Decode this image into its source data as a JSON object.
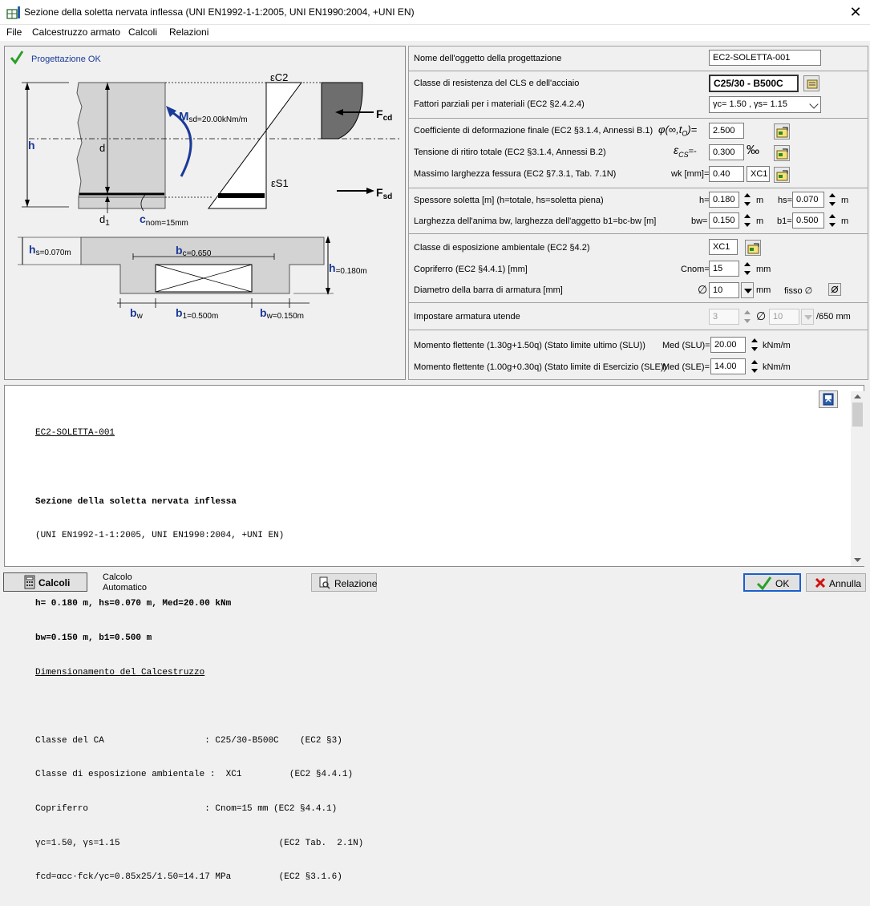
{
  "window": {
    "title": "Sezione della soletta nervata inflessa (UNI EN1992-1-1:2005, UNI EN1990:2004, +UNI EN)",
    "close": "✕"
  },
  "menu": [
    "File",
    "Calcestruzzo armato",
    "Calcoli",
    "Relazioni"
  ],
  "diagram": {
    "status": "Progettazione OK",
    "eps_c2": "εC2",
    "eps_s1": "εS1",
    "m_label": "M",
    "m_sub": "sd=20.00kNm/m",
    "f_cd": "F",
    "f_cd_sub": "cd",
    "f_sd": "F",
    "f_sd_sub": "sd",
    "h": "h",
    "d": "d",
    "d1": "d",
    "d1_sub": "1",
    "cnom": "c",
    "cnom_sub": "nom=15mm",
    "hs": "h",
    "hs_sub": "s=0.070m",
    "bc": "b",
    "bc_sub": "c=0.650",
    "h2": "h",
    "h2_sub": "=0.180m",
    "bw_left": "b",
    "bw_left_sub": "w",
    "b1": "b",
    "b1_sub": "1=0.500m",
    "bw_right": "b",
    "bw_right_sub": "w=0.150m"
  },
  "form": {
    "name_label": "Nome dell'oggetto della progettazione",
    "name_value": "EC2-SOLETTA-001",
    "class_label": "Classe di resistenza del CLS e dell'acciaio",
    "class_value": "C25/30 - B500C",
    "factors_label": "Fattori parziali per i materiali (EC2 §2.4.2.4)",
    "factors_value": "γc= 1.50 , γs= 1.15",
    "creep_label": "Coefficiente di deformazione finale (EC2 §3.1.4, Annessi B.1)",
    "creep_symbol": "φ(∞,t",
    "creep_symbol_sub": "O",
    "creep_symbol_end": ")=",
    "creep_value": "2.500",
    "shrink_label": "Tensione di ritiro totale (EC2 §3.1.4, Annessi B.2)",
    "shrink_symbol": "ε",
    "shrink_symbol_sub": "CS",
    "shrink_symbol_end": "=-",
    "shrink_value": "0.300",
    "shrink_unit": "‰",
    "crack_label": "Massimo larghezza fessura (EC2 §7.3.1, Tab. 7.1N)",
    "crack_symbol": "wk [mm]=",
    "crack_value": "0.40",
    "crack_class": "XC1",
    "thick_label": "Spessore soletta [m] (h=totale, hs=soletta piena)",
    "h_label": "h=",
    "h_value": "0.180",
    "h_unit": "m",
    "hs_label": "hs=",
    "hs_value": "0.070",
    "hs_unit": "m",
    "width_label": "Larghezza dell'anima bw, larghezza dell'aggetto  b1=bc-bw [m]",
    "bw_label": "bw=",
    "bw_value": "0.150",
    "bw_unit": "m",
    "b1_label": "b1=",
    "b1_value": "0.500",
    "b1_unit": "m",
    "exposure_label": "Classe di esposizione ambientale (EC2 §4.2)",
    "exposure_value": "XC1",
    "cover_label": "Copriferro (EC2 §4.4.1) [mm]",
    "cnom_label": "Cnom=",
    "cnom_value": "15",
    "cnom_unit": "mm",
    "diam_label": "Diametro della barra di armatura [mm]",
    "diam_symbol": "∅",
    "diam_value": "10",
    "diam_unit": "mm",
    "fisso_label": "fisso ∅",
    "user_label": "Impostare armatura utende",
    "user_count": "3",
    "user_symbol": "∅",
    "user_diam": "10",
    "user_unit": "/650 mm",
    "msl_label": "Momento flettente (1.30g+1.50q) (Stato limite ultimo (SLU))",
    "msl_field_label": "Med (SLU)=",
    "msl_value": "20.00",
    "msl_unit": "kNm/m",
    "mse_label": "Momento flettente (1.00g+0.30q) (Stato limite di Esercizio (SLE))",
    "mse_field_label": "Med (SLE)=",
    "mse_value": "14.00",
    "mse_unit": "kNm/m"
  },
  "report": {
    "lines": [
      "EC2-SOLETTA-001",
      "",
      "Sezione della soletta nervata inflessa",
      "(UNI EN1992-1-1:2005, UNI EN1990:2004, +UNI EN)",
      "",
      "h= 0.180 m, hs=0.070 m, Med=20.00 kNm",
      "bw=0.150 m, b1=0.500 m",
      "Dimensionamento del Calcestruzzo",
      "",
      "Classe del CA                   : C25/30-B500C    (EC2 §3)",
      "Classe di esposizione ambientale :  XC1         (EC2 §4.4.1)",
      "Copriferro                      : Cnom=15 mm (EC2 §4.4.1)",
      "γc=1.50, γs=1.15                              (EC2 Tab.  2.1N)",
      "fcd=αcc·fck/γc=0.85x25/1.50=14.17 MPa         (EC2 §3.1.6)"
    ]
  },
  "bottom": {
    "calcoli": "Calcoli",
    "auto_line1": "Calcolo",
    "auto_line2": "Automatico",
    "relazione": "Relazione",
    "ok": "OK",
    "annulla": "Annulla"
  }
}
